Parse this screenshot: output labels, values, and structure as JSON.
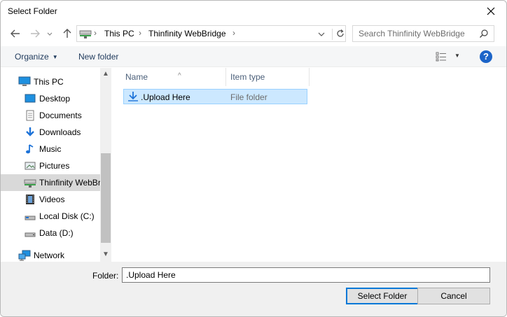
{
  "window": {
    "title": "Select Folder",
    "close_icon": "close-icon"
  },
  "address": {
    "crumbs": [
      "This PC",
      "Thinfinity WebBridge"
    ],
    "search_placeholder": "Search Thinfinity WebBridge"
  },
  "toolbar": {
    "organize_label": "Organize",
    "new_folder_label": "New folder",
    "help_label": "?"
  },
  "nav": {
    "items": [
      {
        "label": "This PC",
        "icon": "computer-icon"
      },
      {
        "label": "Desktop",
        "icon": "desktop-icon"
      },
      {
        "label": "Documents",
        "icon": "documents-icon"
      },
      {
        "label": "Downloads",
        "icon": "downloads-icon"
      },
      {
        "label": "Music",
        "icon": "music-icon"
      },
      {
        "label": "Pictures",
        "icon": "pictures-icon"
      },
      {
        "label": "Thinfinity WebBridge",
        "icon": "network-drive-icon",
        "selected": true
      },
      {
        "label": "Videos",
        "icon": "videos-icon"
      },
      {
        "label": "Local Disk (C:)",
        "icon": "disk-icon"
      },
      {
        "label": "Data (D:)",
        "icon": "disk-icon"
      },
      {
        "label": "Network",
        "icon": "network-icon"
      }
    ]
  },
  "files": {
    "columns": [
      "Name",
      "Item type"
    ],
    "rows": [
      {
        "name": ".Upload Here",
        "type": "File folder"
      }
    ]
  },
  "footer": {
    "folder_label": "Folder:",
    "folder_value": ".Upload Here",
    "select_button": "Select Folder",
    "cancel_button": "Cancel"
  },
  "colors": {
    "accent": "#0078d7",
    "selection": "#cce8ff",
    "help": "#1c64c8"
  }
}
